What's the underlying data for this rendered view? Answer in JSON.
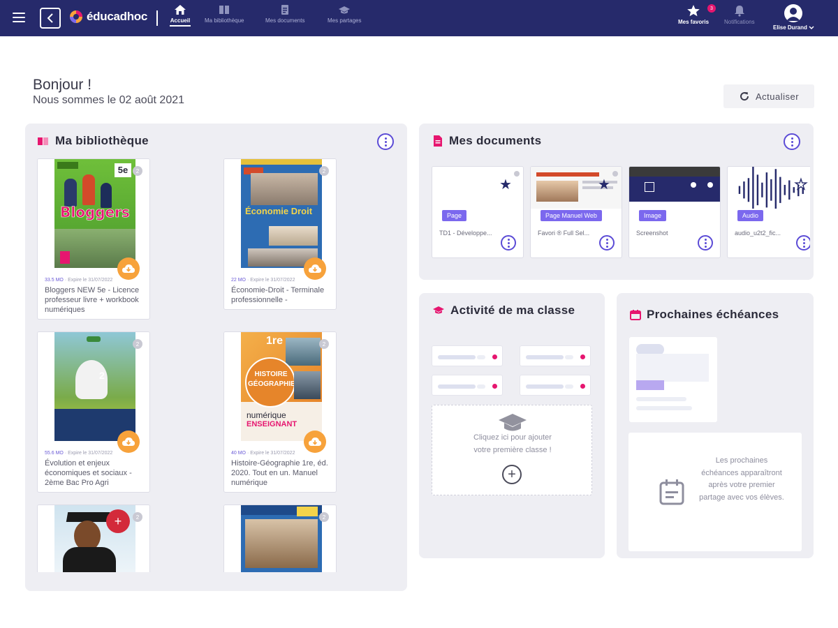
{
  "app": {
    "logo_text": "éducadhoc"
  },
  "nav": [
    {
      "label": "Accueil",
      "icon": "home-icon",
      "active": true
    },
    {
      "label": "Ma bibliothèque",
      "icon": "library-icon",
      "active": false
    },
    {
      "label": "Mes documents",
      "icon": "documents-icon",
      "active": false
    },
    {
      "label": "Mes partages",
      "icon": "shares-icon",
      "active": false
    }
  ],
  "topbar_right": {
    "favorites_label": "Mes favoris",
    "favorites_count": "3",
    "notifications_label": "Notifications",
    "user_name": "Elise Durand"
  },
  "greeting": {
    "title": "Bonjour !",
    "date_text": "Nous sommes le 02 août 2021"
  },
  "refresh_label": "Actualiser",
  "library": {
    "title": "Ma bibliothèque",
    "books": [
      {
        "size": "33.5 MO",
        "expiry": "· Expire le 31/07/2022",
        "title": "Bloggers NEW 5e - Licence professeur livre + workbook numériques"
      },
      {
        "size": "22 MO",
        "expiry": "· Expire le 31/07/2022",
        "title": "Économie-Droit - Terminale professionnelle -"
      },
      {
        "size": "55.6 MO",
        "expiry": "· Expire le 31/07/2022",
        "title": "Évolution et enjeux économiques et sociaux - 2ème Bac Pro Agri"
      },
      {
        "size": "40 MO",
        "expiry": "· Expire le 31/07/2022",
        "title": "Histoire-Géographie 1re, éd. 2020. Tout en un. Manuel numérique"
      },
      {
        "size": "",
        "expiry": "",
        "title": ""
      },
      {
        "size": "",
        "expiry": "",
        "title": ""
      }
    ],
    "cover_texts": {
      "bloggers": "Bloggers",
      "bloggers_level": "5e",
      "eco_droit": "Économie Droit",
      "histoire": "HISTOIRE GÉOGRAPHIE",
      "histoire_level": "1re",
      "numerique": "numérique",
      "enseignant": "ENSEIGNANT"
    }
  },
  "documents": {
    "title": "Mes documents",
    "items": [
      {
        "type": "Page",
        "name": "TD1 - Développe..."
      },
      {
        "type": "Page Manuel Web",
        "name": "Favori ® Full Sel..."
      },
      {
        "type": "Image",
        "name": "Screenshot"
      },
      {
        "type": "Audio",
        "name": "audio_u2t2_fic..."
      }
    ]
  },
  "class_activity": {
    "title": "Activité de ma classe",
    "add_text_line1": "Cliquez ici pour ajouter",
    "add_text_line2": "votre première classe !"
  },
  "deadlines": {
    "title": "Prochaines échéances",
    "empty_text": "Les prochaines échéances apparaîtront après votre premier partage avec vos élèves."
  },
  "colors": {
    "topbar": "#262a6b",
    "accent": "#5b4bd6",
    "type_badge": "#7b68ee",
    "download": "#f7a23b",
    "pink": "#e6166f",
    "panel_bg": "#eeeef3"
  }
}
